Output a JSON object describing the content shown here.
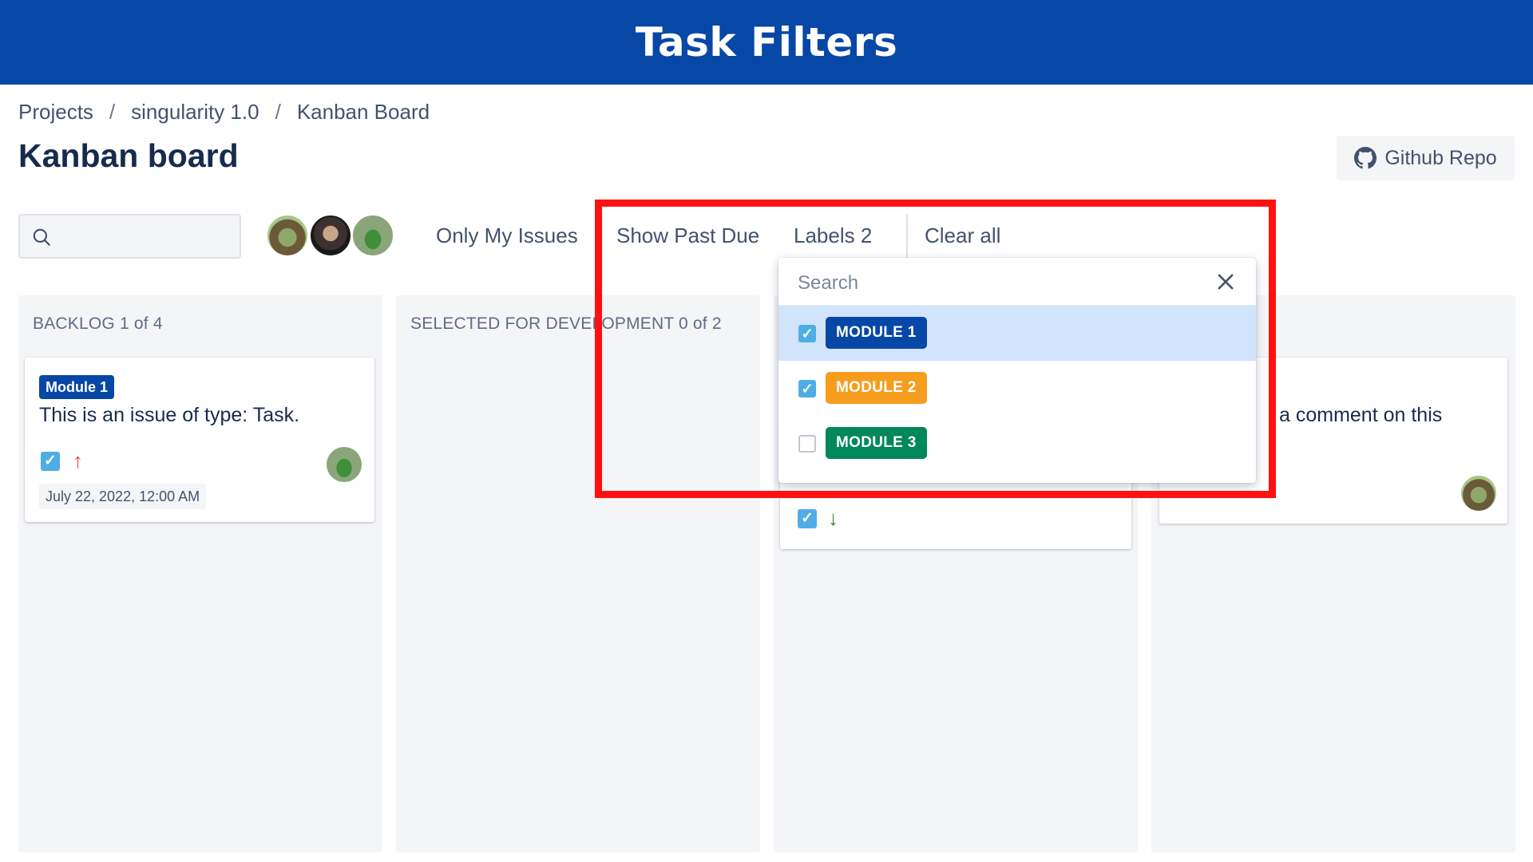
{
  "banner": {
    "title": "Task Filters"
  },
  "breadcrumb": {
    "items": [
      "Projects",
      "singularity 1.0",
      "Kanban Board"
    ],
    "separator": "/"
  },
  "page_title": "Kanban board",
  "github_button": {
    "label": "Github Repo",
    "icon": "github-icon"
  },
  "search": {
    "icon": "search-icon",
    "value": ""
  },
  "filters": {
    "only_my_issues": "Only My Issues",
    "show_past_due": "Show Past Due",
    "labels": "Labels 2",
    "clear_all": "Clear all"
  },
  "columns": [
    {
      "title": "BACKLOG 1 of 4",
      "cards": [
        {
          "label": "Module 1",
          "title": "This is an issue of type: Task.",
          "date": "July 22, 2022, 12:00 AM",
          "priority_icon": "arrow-up-icon"
        }
      ]
    },
    {
      "title": "SELECTED FOR DEVELOPMENT 0 of 2",
      "cards": []
    },
    {
      "title": "",
      "cards": [
        {
          "priority_icon": "arrow-down-icon"
        }
      ]
    },
    {
      "title": "",
      "cards": [
        {
          "title_fragment": "a comment on this"
        }
      ]
    }
  ],
  "label_dropdown": {
    "search_placeholder": "Search",
    "options": [
      {
        "label": "MODULE 1",
        "checked": true,
        "color": "#0747a6"
      },
      {
        "label": "MODULE 2",
        "checked": true,
        "color": "#f69d1e"
      },
      {
        "label": "MODULE 3",
        "checked": false,
        "color": "#00875a"
      }
    ]
  },
  "colors": {
    "brand": "#0747a6",
    "highlight": "#ff1111",
    "checkbox": "#4fade6",
    "priority_high": "#e5493a",
    "priority_low": "#2e8738"
  }
}
